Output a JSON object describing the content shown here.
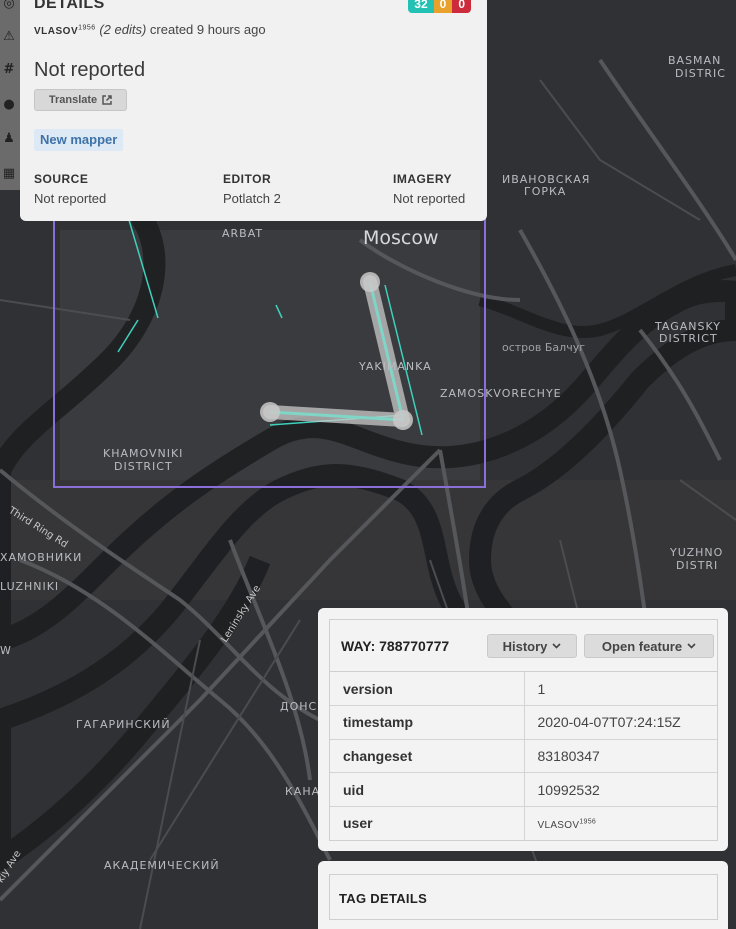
{
  "map": {
    "labels": {
      "moscow": "Moscow",
      "arbat": "ARBAT",
      "yakimanka": "YAKIMANKA",
      "zamoskvorechye": "ZAMOSKVORECHYE",
      "khamovniki_1": "KHAMOVNIKI",
      "khamovniki_2": "DISTRICT",
      "basmanny_1": "BASMAN",
      "basmanny_2": "DISTRIC",
      "ivanovskaya_1": "ИВАНОВСКАЯ",
      "ivanovskaya_2": "ГОРКА",
      "tagansky_1": "TAGANSKY",
      "tagansky_2": "DISTRICT",
      "ostrov": "остров Балчуг",
      "third_ring": "Third Ring Rd",
      "khamovniki_ru": "ХАМОВНИКИ",
      "luzhniki": "LUZHNIKI",
      "leninsky": "Leninsky Ave",
      "gagarinsky": "ГАГАРИНСКИЙ",
      "donskoy": "ДОНСК",
      "akademichesky": "АКАДЕМИЧЕСКИЙ",
      "yuzhnoport_1": "YUZHNO",
      "yuzhnoport_2": "DISTRI",
      "kashira": "КАНА",
      "kiy_ave": "kiy Ave",
      "w_label": "W"
    },
    "colors": {
      "way": "#7fd6c6",
      "halo": "#c9c9c9",
      "bbox": "#8a6fd8"
    }
  },
  "details": {
    "title": "DETAILS",
    "badges": [
      {
        "value": "32",
        "color": "#22c1b3"
      },
      {
        "value": "0",
        "color": "#e8a12b"
      },
      {
        "value": "0",
        "color": "#cc2b3b"
      }
    ],
    "user": "VLASOV",
    "user_sup": "1956",
    "edits": "(2 edits)",
    "created": "created 9 hours ago",
    "comment": "Not reported",
    "translate_label": "Translate",
    "new_mapper_label": "New mapper",
    "columns": [
      {
        "header": "SOURCE",
        "value": "Not reported"
      },
      {
        "header": "EDITOR",
        "value": "Potlatch 2"
      },
      {
        "header": "IMAGERY",
        "value": "Not reported"
      }
    ]
  },
  "way": {
    "title": "WAY: 788770777",
    "history_label": "History",
    "open_feature_label": "Open feature",
    "rows": [
      {
        "key": "version",
        "value": "1"
      },
      {
        "key": "timestamp",
        "value": "2020-04-07T07:24:15Z"
      },
      {
        "key": "changeset",
        "value": "83180347"
      },
      {
        "key": "uid",
        "value": "10992532"
      }
    ],
    "user_key": "user",
    "user_value": "VLASOV",
    "user_sup": "1956"
  },
  "tags": {
    "title": "TAG DETAILS"
  }
}
